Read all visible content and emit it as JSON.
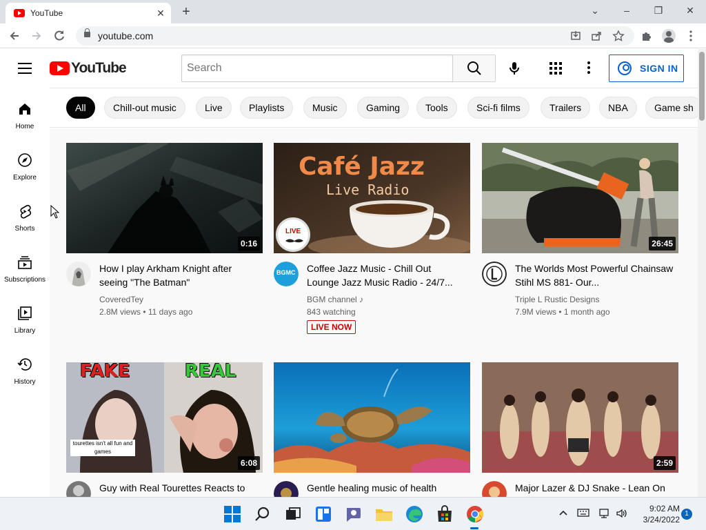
{
  "browser": {
    "tab_title": "YouTube",
    "tab_close": "✕",
    "new_tab": "+",
    "url": "youtube.com",
    "window_controls": {
      "minimize": "–",
      "restore": "❐",
      "close": "✕",
      "tab_search": "⌄"
    }
  },
  "header": {
    "logo_text": "YouTube",
    "search_placeholder": "Search",
    "signin_label": "SIGN IN",
    "colors": {
      "brand": "#ff0000",
      "link": "#065fd4"
    }
  },
  "sidebar": {
    "items": [
      {
        "label": "Home",
        "icon": "home-icon"
      },
      {
        "label": "Explore",
        "icon": "compass-icon"
      },
      {
        "label": "Shorts",
        "icon": "shorts-icon"
      },
      {
        "label": "Subscriptions",
        "icon": "subscriptions-icon"
      },
      {
        "label": "Library",
        "icon": "library-icon"
      },
      {
        "label": "History",
        "icon": "history-icon"
      }
    ]
  },
  "chips": [
    {
      "label": "All",
      "active": true
    },
    {
      "label": "Chill-out music"
    },
    {
      "label": "Live"
    },
    {
      "label": "Playlists"
    },
    {
      "label": "Music"
    },
    {
      "label": "Gaming"
    },
    {
      "label": "Tools"
    },
    {
      "label": "Sci-fi films"
    },
    {
      "label": "Trailers"
    },
    {
      "label": "NBA"
    },
    {
      "label": "Game sh"
    }
  ],
  "videos": [
    {
      "title": "How I play Arkham Knight after seeing \"The Batman\"",
      "channel": "CoveredTey",
      "meta": "2.8M views • 11 days ago",
      "duration": "0:16"
    },
    {
      "title": "Coffee Jazz Music - Chill Out Lounge Jazz Music Radio - 24/7...",
      "channel": "BGM channel ♪",
      "meta": "843 watching",
      "badge": "LIVE NOW",
      "thumb_text_1": "Café Jazz",
      "thumb_text_2": "Live Radio",
      "thumb_live": "LIVE",
      "avatar_text": "BGMC"
    },
    {
      "title": "The Worlds Most Powerful Chainsaw Stihl MS 881- Our...",
      "channel": "Triple L Rustic Designs",
      "meta": "7.9M views • 1 month ago",
      "duration": "26:45"
    },
    {
      "title": "Guy with Real Tourettes Reacts to",
      "duration": "6:08",
      "thumb_fake": "FAKE",
      "thumb_real": "REAL",
      "thumb_caption": "tourettes isn't all fun and games"
    },
    {
      "title": "Gentle healing music of health"
    },
    {
      "title": "Major Lazer & DJ Snake - Lean On",
      "duration": "2:59"
    }
  ],
  "taskbar": {
    "time": "9:02 AM",
    "date": "3/24/2022",
    "notification_count": "1"
  }
}
